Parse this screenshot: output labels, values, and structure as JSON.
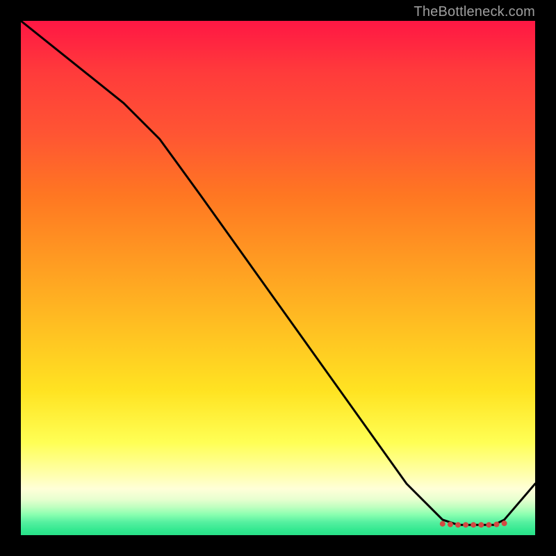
{
  "watermark": "TheBottleneck.com",
  "chart_data": {
    "type": "line",
    "title": "",
    "xlabel": "",
    "ylabel": "",
    "xlim": [
      0,
      100
    ],
    "ylim": [
      0,
      100
    ],
    "series": [
      {
        "name": "curve",
        "x": [
          0,
          10,
          20,
          27,
          35,
          45,
          55,
          65,
          75,
          82,
          85,
          88,
          90,
          92,
          94,
          100
        ],
        "y": [
          100,
          92,
          84,
          77,
          66,
          52,
          38,
          24,
          10,
          3,
          2,
          2,
          2,
          2,
          3,
          10
        ]
      }
    ],
    "markers": {
      "x": [
        82,
        83.5,
        85,
        86.5,
        88,
        89.5,
        91,
        92.5,
        94
      ],
      "y": [
        2.2,
        2.1,
        2.0,
        2.0,
        2.0,
        2.0,
        2.0,
        2.1,
        2.3
      ],
      "color": "#d24a43",
      "radius": 4
    },
    "gradient_stops": [
      {
        "pos": 0,
        "color": "#ff1744"
      },
      {
        "pos": 50,
        "color": "#ffcc22"
      },
      {
        "pos": 85,
        "color": "#ffff88"
      },
      {
        "pos": 100,
        "color": "#28e088"
      }
    ]
  }
}
